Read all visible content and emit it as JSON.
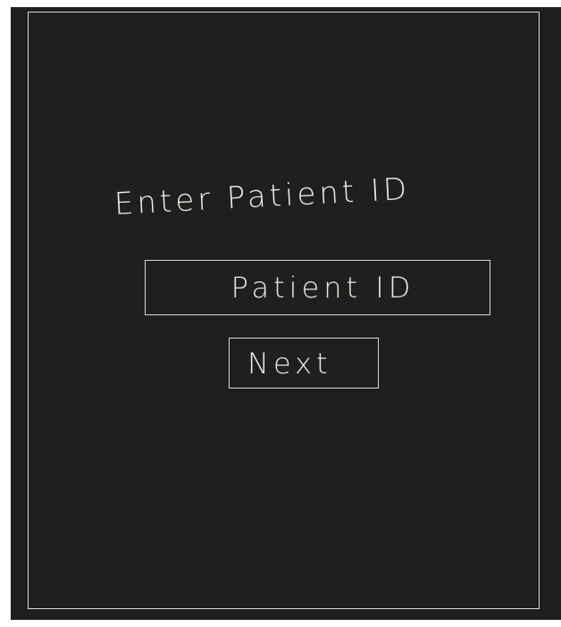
{
  "prompt": {
    "text": "Enter Patient ID"
  },
  "patient_id_field": {
    "placeholder": "Patient ID",
    "value": ""
  },
  "next_button": {
    "label": "Next"
  },
  "colors": {
    "background": "#201f1d",
    "stroke": "#d8d8d6",
    "text": "#e9e9e6"
  }
}
